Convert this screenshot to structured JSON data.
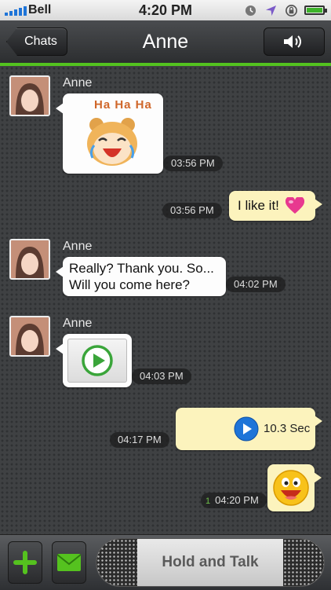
{
  "status_bar": {
    "carrier": "Bell",
    "time": "4:20 PM",
    "icons": [
      "signal-bars-icon",
      "clock-icon",
      "location-arrow-icon",
      "rotation-lock-icon",
      "battery-icon"
    ]
  },
  "nav": {
    "back_label": "Chats",
    "title": "Anne",
    "right_icon": "speaker-icon"
  },
  "messages": [
    {
      "id": 1,
      "from": "Anne",
      "side": "left",
      "type": "sticker",
      "sticker_text": "Ha Ha Ha",
      "time": "03:56 PM"
    },
    {
      "id": 2,
      "from": "me",
      "side": "right",
      "type": "text",
      "text": "I like it!",
      "emoji": "heart-icon",
      "time": "03:56 PM"
    },
    {
      "id": 3,
      "from": "Anne",
      "side": "left",
      "type": "text",
      "lines": [
        "Really? Thank you. So...",
        "Will you come here?"
      ],
      "time": "04:02 PM"
    },
    {
      "id": 4,
      "from": "Anne",
      "side": "left",
      "type": "video",
      "time": "04:03 PM"
    },
    {
      "id": 5,
      "from": "me",
      "side": "right",
      "type": "voice",
      "duration": "10.3 Sec",
      "time": "04:17 PM"
    },
    {
      "id": 6,
      "from": "me",
      "side": "right",
      "type": "emoji",
      "emoji": "laughing-face-icon",
      "time": "04:20 PM",
      "count": "1"
    }
  ],
  "toolbar": {
    "add_icon": "plus-icon",
    "message_icon": "envelope-icon",
    "talk_label": "Hold and Talk"
  },
  "colors": {
    "accent_green": "#53c21f",
    "bubble_incoming": "#fdfdfd",
    "bubble_outgoing": "#fcf3bd",
    "play_blue": "#1e74d8"
  }
}
